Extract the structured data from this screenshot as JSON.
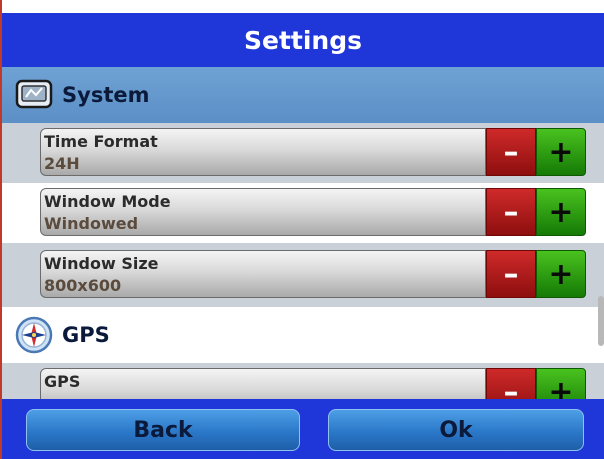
{
  "header": {
    "title": "Settings"
  },
  "sections": {
    "system": {
      "label": "System",
      "icon": "system-monitor-icon"
    },
    "gps": {
      "label": "GPS",
      "icon": "compass-icon"
    }
  },
  "settings": [
    {
      "name": "Time Format",
      "value": "24H"
    },
    {
      "name": "Window Mode",
      "value": "Windowed"
    },
    {
      "name": "Window Size",
      "value": "800x600"
    },
    {
      "name": "GPS",
      "value": ""
    }
  ],
  "buttons": {
    "minus": "–",
    "plus": "+"
  },
  "footer": {
    "back_label": "Back",
    "ok_label": "Ok"
  },
  "colors": {
    "title_bar": "#1f37d8",
    "section_band": "#6fa2d4",
    "minus_button": "#b71c1c",
    "plus_button": "#2ea70f",
    "footer_button": "#2b78c9"
  }
}
